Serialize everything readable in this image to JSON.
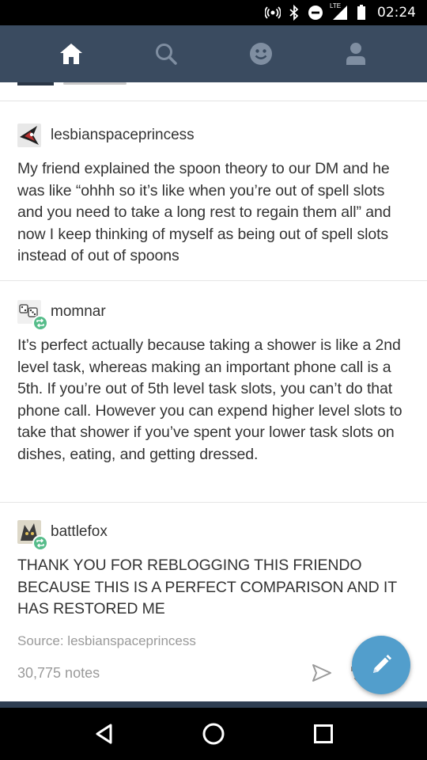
{
  "status_bar": {
    "time": "02:24",
    "network_label": "LTE",
    "icons": [
      "hotspot-icon",
      "bluetooth-icon",
      "do-not-disturb-icon",
      "signal-icon",
      "battery-icon"
    ]
  },
  "nav": {
    "items": [
      {
        "name": "home",
        "icon": "home-icon",
        "active": true
      },
      {
        "name": "search",
        "icon": "search-icon",
        "active": false
      },
      {
        "name": "activity",
        "icon": "smiley-icon",
        "active": false
      },
      {
        "name": "account",
        "icon": "person-icon",
        "active": false
      }
    ]
  },
  "posts": [
    {
      "username": "lesbianspaceprincess",
      "reblog": false,
      "body": "My friend explained the spoon theory to our DM and he was like “ohhh so it’s like when you’re out of spell slots and you need to take a long rest to regain them all” and now I keep thinking of myself as being out of spell slots instead of out of spoons"
    },
    {
      "username": "momnar",
      "reblog": true,
      "body": "It’s perfect actually because taking a shower is like a 2nd level task, whereas making an important phone call is a 5th. If you’re out of 5th level task slots, you can’t do that phone call. However you can expend higher level slots to take that shower if you’ve spent your lower task slots on dishes, eating, and getting dressed."
    },
    {
      "username": "battlefox",
      "reblog": true,
      "body": "THANK YOU FOR REBLOGGING THIS FRIENDO BECAUSE THIS IS A PERFECT COMPARISON AND IT HAS RESTORED ME"
    }
  ],
  "post_footer": {
    "source": "Source: lesbianspaceprincess",
    "notes": "30,775 notes",
    "actions": [
      "share-icon",
      "reblog-icon",
      "like-icon"
    ]
  },
  "fab": {
    "icon": "pencil-icon"
  },
  "system_nav": [
    "back-icon",
    "home-circle-icon",
    "recents-icon"
  ],
  "colors": {
    "nav_bg": "#3a4b60",
    "reblog_green": "#56bc8a",
    "fab_blue": "#529ecc",
    "text": "#333333",
    "muted": "#9a9a9a"
  }
}
